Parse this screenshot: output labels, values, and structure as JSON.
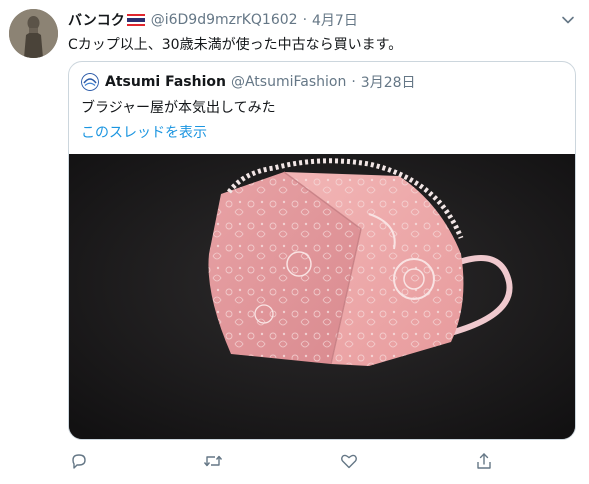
{
  "tweet": {
    "display_name": "バンコク",
    "flag_icon": "thailand-flag-icon",
    "handle": "@i6D9d9mzrKQ1602",
    "separator": "·",
    "date": "4月7日",
    "text": "Cカップ以上、30歳未満が使った中古なら買います。"
  },
  "quoted_tweet": {
    "display_name": "Atsumi Fashion",
    "handle": "@AtsumiFashion",
    "separator": "·",
    "date": "3月28日",
    "text": "ブラジャー屋が本気出してみた",
    "show_thread": "このスレッドを表示",
    "photo_subject": "pink-lace-face-mask"
  },
  "actions": [
    "reply-icon",
    "retweet-icon",
    "like-icon",
    "share-icon"
  ],
  "colors": {
    "text": "#14171a",
    "secondary": "#657786",
    "link": "#1b95e0",
    "border": "#ccd6dd"
  }
}
